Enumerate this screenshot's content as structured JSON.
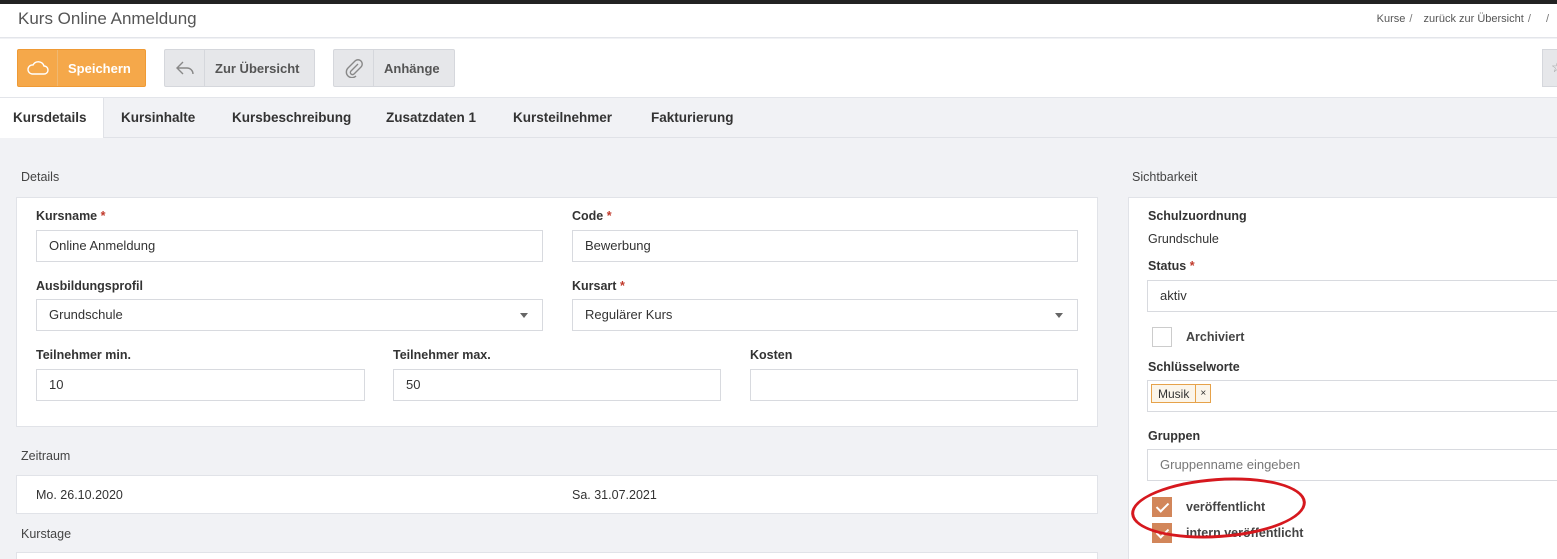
{
  "header": {
    "title": "Kurs Online Anmeldung",
    "breadcrumb": [
      "Kurse",
      "zurück zur Übersicht",
      ""
    ]
  },
  "toolbar": {
    "save_label": "Speichern",
    "back_label": "Zur Übersicht",
    "attachments_label": "Anhänge"
  },
  "tabs": [
    "Kursdetails",
    "Kursinhalte",
    "Kursbeschreibung",
    "Zusatzdaten 1",
    "Kursteilnehmer",
    "Fakturierung"
  ],
  "details": {
    "section_title": "Details",
    "kursname_label": "Kursname",
    "kursname_value": "Online Anmeldung",
    "code_label": "Code",
    "code_value": "Bewerbung",
    "ausbildungsprofil_label": "Ausbildungsprofil",
    "ausbildungsprofil_value": "Grundschule",
    "kursart_label": "Kursart",
    "kursart_value": "Regulärer Kurs",
    "teilnehmer_min_label": "Teilnehmer min.",
    "teilnehmer_min_value": "10",
    "teilnehmer_max_label": "Teilnehmer max.",
    "teilnehmer_max_value": "50",
    "kosten_label": "Kosten",
    "kosten_value": "",
    "required_mark": "*"
  },
  "zeitraum": {
    "section_title": "Zeitraum",
    "start": "Mo. 26.10.2020",
    "end": "Sa. 31.07.2021"
  },
  "kurstage": {
    "section_title": "Kurstage"
  },
  "sichtbarkeit": {
    "section_title": "Sichtbarkeit",
    "schulzuordnung_label": "Schulzuordnung",
    "schulzuordnung_value": "Grundschule",
    "status_label": "Status",
    "status_value": "aktiv",
    "archiviert_label": "Archiviert",
    "archiviert_checked": false,
    "schluesselworte_label": "Schlüsselworte",
    "schluesselworte_tags": [
      "Musik"
    ],
    "tag_remove": "×",
    "gruppen_label": "Gruppen",
    "gruppen_placeholder": "Gruppenname eingeben",
    "veroeffentlicht_label": "veröffentlicht",
    "veroeffentlicht_checked": true,
    "intern_label": "intern veröffentlicht",
    "intern_checked": true
  },
  "colors": {
    "accent": "#f5a84a",
    "checkbox": "#d2865a",
    "annotation": "#d6181e"
  }
}
